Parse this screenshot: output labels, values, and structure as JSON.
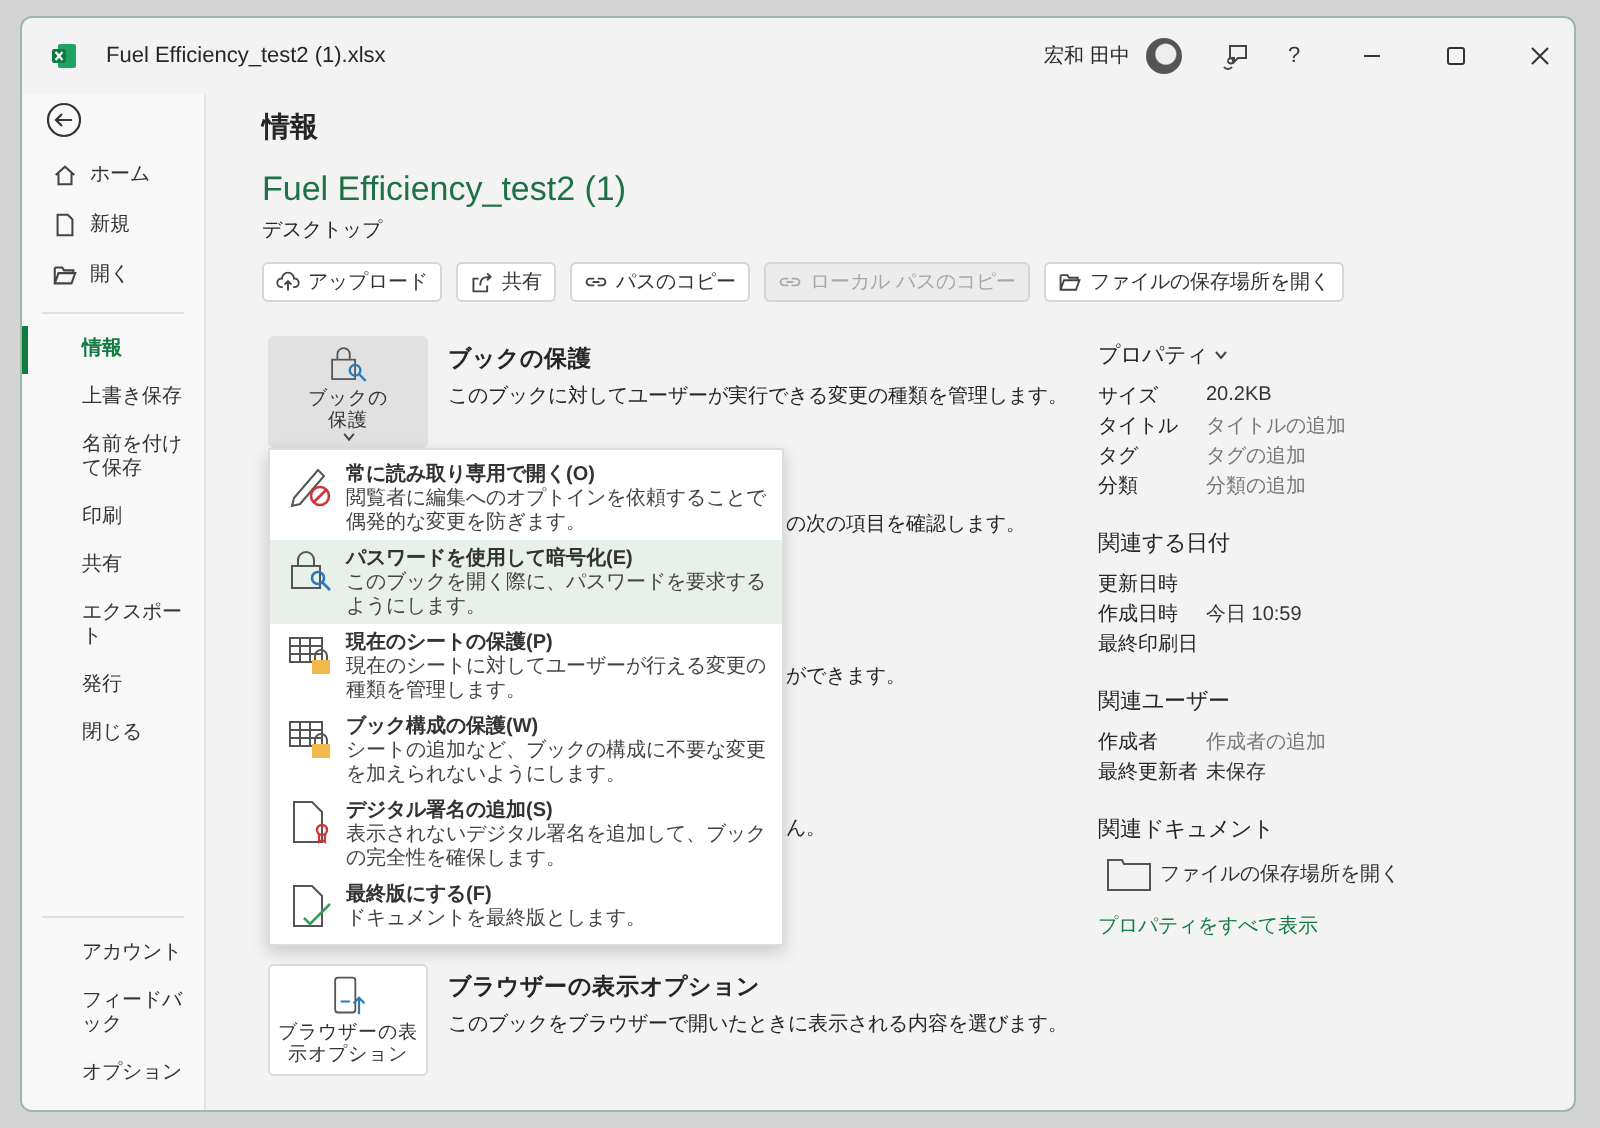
{
  "window": {
    "title": "Fuel Efficiency_test2 (1).xlsx",
    "user_name": "宏和 田中",
    "help": "?"
  },
  "sidebar": {
    "top_items": [
      {
        "label": "ホーム",
        "selected": false
      },
      {
        "label": "新規",
        "selected": false
      },
      {
        "label": "開く",
        "selected": false
      }
    ],
    "items": [
      {
        "label": "情報",
        "selected": true
      },
      {
        "label": "上書き保存",
        "selected": false
      },
      {
        "label": "名前を付けて保存",
        "selected": false
      },
      {
        "label": "印刷",
        "selected": false
      },
      {
        "label": "共有",
        "selected": false
      },
      {
        "label": "エクスポート",
        "selected": false
      },
      {
        "label": "発行",
        "selected": false
      },
      {
        "label": "閉じる",
        "selected": false
      }
    ],
    "bottom_items": [
      {
        "label": "アカウント",
        "selected": false
      },
      {
        "label": "フィードバック",
        "selected": false
      },
      {
        "label": "オプション",
        "selected": false
      }
    ]
  },
  "page_title": "情報",
  "file": {
    "name": "Fuel Efficiency_test2 (1)",
    "location": "デスクトップ"
  },
  "actions": [
    {
      "label": "アップロード",
      "disabled": false
    },
    {
      "label": "共有",
      "disabled": false
    },
    {
      "label": "パスのコピー",
      "disabled": false
    },
    {
      "label": "ローカル パスのコピー",
      "disabled": true
    },
    {
      "label": "ファイルの保存場所を開く",
      "disabled": false
    }
  ],
  "protect": {
    "button_label": "ブックの保護",
    "heading": "ブックの保護",
    "description": "このブックに対してユーザーが実行できる変更の種類を管理します。",
    "expanded": true
  },
  "protect_menu": [
    {
      "title": "常に読み取り専用で開く(O)",
      "description": "閲覧者に編集へのオプトインを依頼することで偶発的な変更を防ぎます。",
      "selected": false
    },
    {
      "title": "パスワードを使用して暗号化(E)",
      "description": "このブックを開く際に、パスワードを要求するようにします。",
      "selected": true
    },
    {
      "title": "現在のシートの保護(P)",
      "description": "現在のシートに対してユーザーが行える変更の種類を管理します。",
      "selected": false
    },
    {
      "title": "ブック構成の保護(W)",
      "description": "シートの追加など、ブックの構成に不要な変更を加えられないようにします。",
      "selected": false
    },
    {
      "title": "デジタル署名の追加(S)",
      "description": "表示されないデジタル署名を追加して、ブックの完全性を確保します。",
      "selected": false
    },
    {
      "title": "最終版にする(F)",
      "description": "ドキュメントを最終版とします。",
      "selected": false
    }
  ],
  "sections_behind_menu": [
    {
      "visible_text": "の次の項目を確認します。"
    },
    {
      "visible_text": "ができます。"
    },
    {
      "visible_text": "ん。"
    }
  ],
  "browser_options": {
    "button_label": "ブラウザーの表示オプション",
    "heading": "ブラウザーの表示オプション",
    "description": "このブックをブラウザーで開いたときに表示される内容を選びます。"
  },
  "properties": {
    "heading": "プロパティ",
    "rows": [
      {
        "label": "サイズ",
        "value": "20.2KB",
        "kind": "value"
      },
      {
        "label": "タイトル",
        "value": "タイトルの追加",
        "kind": "placeholder"
      },
      {
        "label": "タグ",
        "value": "タグの追加",
        "kind": "placeholder"
      },
      {
        "label": "分類",
        "value": "分類の追加",
        "kind": "placeholder"
      }
    ]
  },
  "related_dates": {
    "heading": "関連する日付",
    "rows": [
      {
        "label": "更新日時"
      },
      {
        "label": "作成日時",
        "value": "今日 10:59",
        "kind": "value"
      },
      {
        "label": "最終印刷日"
      }
    ]
  },
  "related_people": {
    "heading": "関連ユーザー",
    "rows": [
      {
        "label": "作成者",
        "value": "作成者の追加",
        "kind": "placeholder"
      },
      {
        "label": "最終更新者",
        "value": "未保存",
        "kind": "value"
      }
    ]
  },
  "related_documents": {
    "heading": "関連ドキュメント",
    "link": "ファイルの保存場所を開く"
  },
  "show_all_link": "プロパティをすべて表示"
}
